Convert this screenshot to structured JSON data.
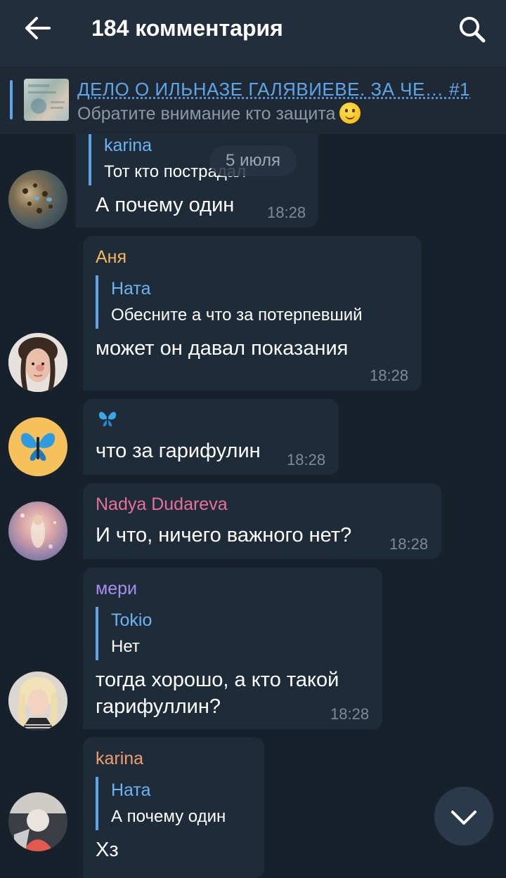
{
  "header": {
    "title": "184 комментария",
    "back_icon": "arrow-left-icon",
    "search_icon": "search-icon"
  },
  "pinned": {
    "title": "ДЕЛО О ИЛЬНАЗЕ ГАЛЯВИЕВЕ. ЗА ЧЕ… #1",
    "subtitle": "Обратите внимание кто защита",
    "emoji_icon": "smile-emoji-icon"
  },
  "date_chip": "5 июля",
  "messages": [
    {
      "reply_name": "karina",
      "reply_text": "Тот кто пострадал",
      "text": "А почему  один",
      "time": "18:28"
    },
    {
      "sender": "Аня",
      "sender_color": "#f5b65e",
      "reply_name": "Ната",
      "reply_text": "Обесните  а что за потерпевший",
      "text": "может он давал показания",
      "time": "18:28"
    },
    {
      "text": "что за гарифулин",
      "emoji_icon": "butterfly-icon",
      "time": "18:28"
    },
    {
      "sender": "Nadya Dudareva",
      "sender_color": "#ea6f9b",
      "text": "И что, ничего важного нет?",
      "time": "18:28"
    },
    {
      "sender": "мери",
      "sender_color": "#a98df0",
      "reply_name": "Tokio",
      "reply_text": "Нет",
      "text_line1": "тогда хорошо, а кто такой",
      "text_line2": "гарифуллин?",
      "time": "18:28"
    },
    {
      "sender": "karina",
      "sender_color": "#f29d6e",
      "reply_name": "Ната",
      "reply_text": "А почему  один",
      "text": "Хз"
    }
  ],
  "scroll_down_icon": "chevron-down-icon",
  "colors": {
    "background": "#17212b",
    "bubble": "#1e2c3a",
    "accent": "#5fa6e8"
  }
}
